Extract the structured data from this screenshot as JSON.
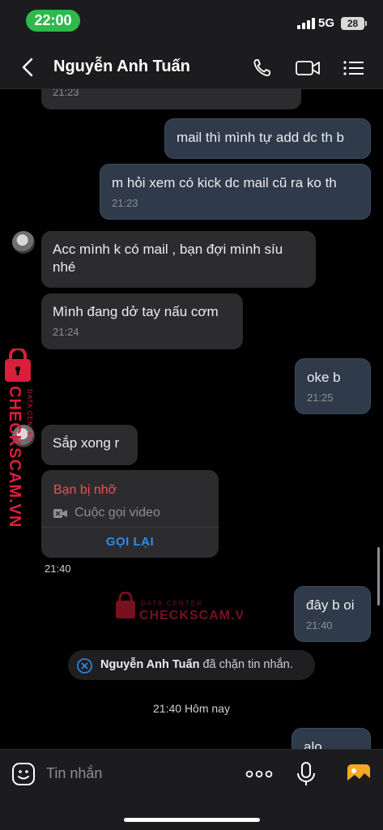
{
  "status_bar": {
    "time": "22:00",
    "network": "5G",
    "battery": "28"
  },
  "header": {
    "title": "Nguyễn Anh Tuấn"
  },
  "messages": [
    {
      "id": "m0",
      "time": "21:23"
    },
    {
      "id": "m1",
      "text": "mail thì mình tự add dc th b"
    },
    {
      "id": "m2",
      "text": "m hỏi xem có kick dc mail cũ ra ko th",
      "time": "21:23"
    },
    {
      "id": "m3",
      "text": "Acc mình k có mail , bạn đợi mình síu nhé"
    },
    {
      "id": "m4",
      "text": "Mình đang dở tay nấu cơm",
      "time": "21:24"
    },
    {
      "id": "m5",
      "text": "oke b",
      "time": "21:25"
    },
    {
      "id": "m6",
      "text": "Sắp xong r"
    },
    {
      "id": "m7",
      "text": "đây b oi",
      "time": "21:40"
    },
    {
      "id": "m8",
      "text": "alo"
    }
  ],
  "missed_call": {
    "title": "Bạn bị nhỡ",
    "subtitle": "Cuộc gọi video",
    "action": "GỌI LẠI",
    "time": "21:40"
  },
  "system_notice": {
    "name": "Nguyễn Anh Tuấn",
    "text": " đã chặn tin nhắn."
  },
  "date_separator": "21:40 Hôm nay",
  "watermark": {
    "brand": "CHECKSCAM.VN",
    "tag": "DATA CENTER"
  },
  "input": {
    "placeholder": "Tin nhắn"
  },
  "colors": {
    "accent": "#2e8cf0",
    "missed": "#ef4f55",
    "watermark": "#d81f3b",
    "status_time": "#2fb94a"
  }
}
